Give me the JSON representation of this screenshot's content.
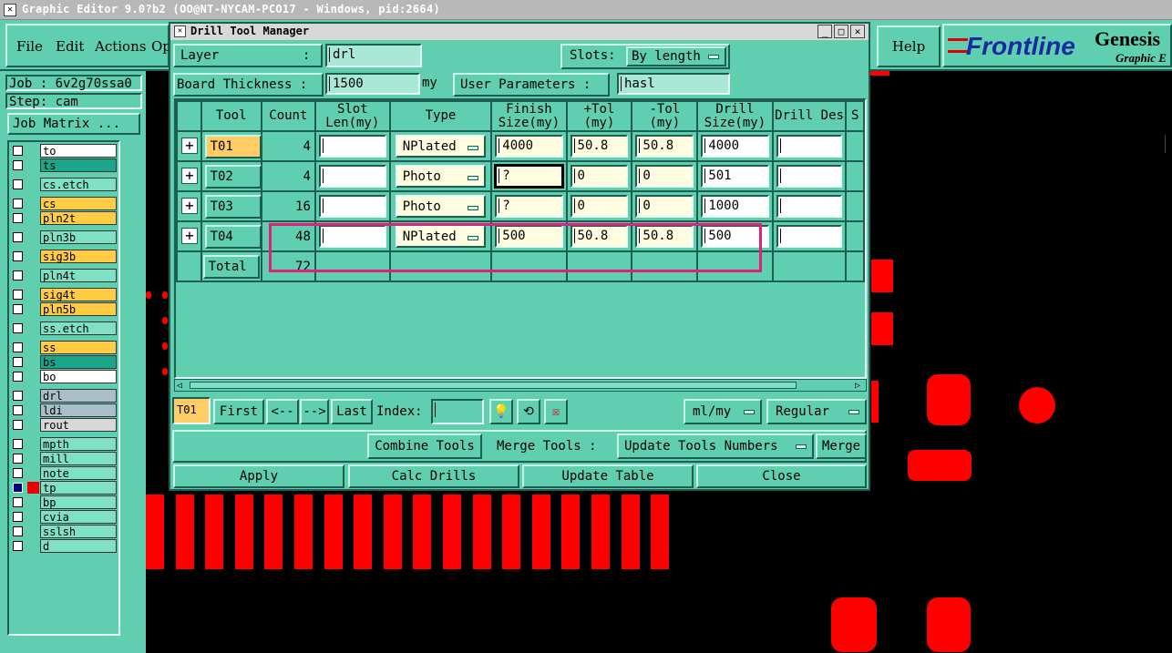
{
  "app": {
    "title": "Graphic Editor 9.0?b2 (OO@NT-NYCAM-PCO17 - Windows, pid:2664)"
  },
  "menubar": {
    "file": "File",
    "edit": "Edit",
    "actions": "Actions",
    "op": "Op",
    "help": "Help"
  },
  "brand": {
    "logo": "Frontline",
    "product": "Genesis",
    "sub": "Graphic E"
  },
  "job": {
    "job_text": "Job : 6v2g70ssa0",
    "step_text": "Step: cam",
    "matrix_button": "Job Matrix ..."
  },
  "layers": [
    {
      "name": "to",
      "color": "#ffffff"
    },
    {
      "name": "ts",
      "color": "#1ba589"
    },
    {
      "name": "cs.etch",
      "color": "#7fe0c4"
    },
    {
      "name": "cs",
      "color": "#ffcc44"
    },
    {
      "name": "pln2t",
      "color": "#ffcc44"
    },
    {
      "name": "pln3b",
      "color": "#7fe0c4"
    },
    {
      "name": "sig3b",
      "color": "#ffcc44"
    },
    {
      "name": "pln4t",
      "color": "#7fe0c4"
    },
    {
      "name": "sig4t",
      "color": "#ffcc44"
    },
    {
      "name": "pln5b",
      "color": "#ffcc44"
    },
    {
      "name": "ss.etch",
      "color": "#7fe0c4"
    },
    {
      "name": "ss",
      "color": "#ffcc44"
    },
    {
      "name": "bs",
      "color": "#1ba589"
    },
    {
      "name": "bo",
      "color": "#ffffff"
    },
    {
      "name": "drl",
      "color": "#a9bec9"
    },
    {
      "name": "ldi",
      "color": "#a9bec9"
    },
    {
      "name": "rout",
      "color": "#d8d8d8"
    },
    {
      "name": "mpth",
      "color": "#7fe0c4"
    },
    {
      "name": "mill",
      "color": "#7fe0c4"
    },
    {
      "name": "note",
      "color": "#7fe0c4"
    },
    {
      "name": "tp",
      "color": "#7fe0c4"
    },
    {
      "name": "bp",
      "color": "#7fe0c4"
    },
    {
      "name": "cvia",
      "color": "#7fe0c4"
    },
    {
      "name": "sslsh",
      "color": "#7fe0c4"
    },
    {
      "name": "d",
      "color": "#7fe0c4"
    }
  ],
  "dialog": {
    "title": "Drill Tool Manager",
    "layer_label": "Layer",
    "layer_colon": ":",
    "layer_value": "drl",
    "slots_label": "Slots:",
    "slots_value": "By length",
    "thickness_label": "Board Thickness :",
    "thickness_value": "1500",
    "thickness_unit": "my",
    "user_params_label": "User Parameters :",
    "user_params_value": "hasl",
    "columns": [
      "Tool",
      "Count",
      "Slot Len(my)",
      "Type",
      "Finish Size(my)",
      "+Tol (my)",
      "-Tol (my)",
      "Drill Size(my)",
      "Drill Des",
      "S"
    ],
    "rows": [
      {
        "tool": "T01",
        "count": "4",
        "type": "NPlated",
        "finish": "4000",
        "ptol": "50.8",
        "mtol": "50.8",
        "drill": "4000"
      },
      {
        "tool": "T02",
        "count": "4",
        "type": "Photo",
        "finish": "?",
        "ptol": "0",
        "mtol": "0",
        "drill": "501"
      },
      {
        "tool": "T03",
        "count": "16",
        "type": "Photo",
        "finish": "?",
        "ptol": "0",
        "mtol": "0",
        "drill": "1000"
      },
      {
        "tool": "T04",
        "count": "48",
        "type": "NPlated",
        "finish": "500",
        "ptol": "50.8",
        "mtol": "50.8",
        "drill": "500"
      }
    ],
    "total_label": "Total",
    "total_count": "72",
    "nav": {
      "current": "T01",
      "first": "First",
      "prev": "<--",
      "next": "-->",
      "last": "Last",
      "index_label": "Index:",
      "units": "ml/my",
      "mode": "Regular"
    },
    "actions": {
      "combine": "Combine Tools",
      "merge_label": "Merge Tools :",
      "update_numbers": "Update Tools Numbers",
      "merge": "Merge"
    },
    "bottom": {
      "apply": "Apply",
      "calc": "Calc Drills",
      "update_table": "Update Table",
      "close": "Close"
    }
  },
  "colors": {
    "teal": "#5fcfb0",
    "highlight": "#e0207a",
    "pad": "#ff0000",
    "selected_tool": "#ffcc66"
  }
}
